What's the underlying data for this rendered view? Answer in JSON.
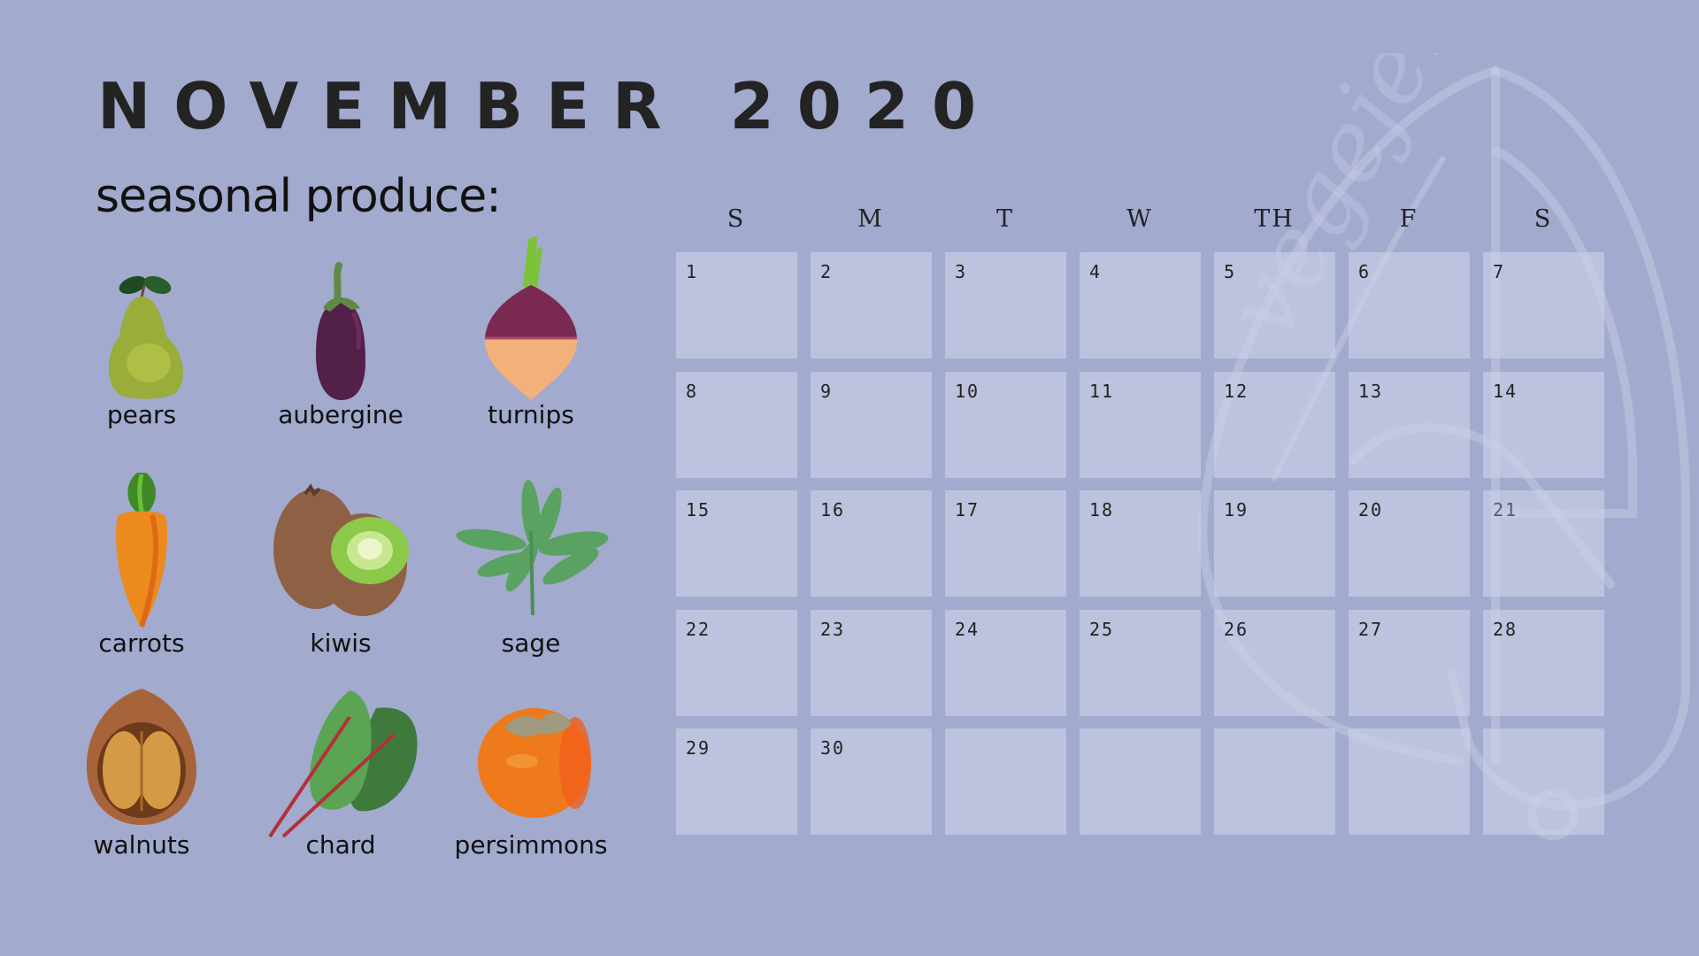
{
  "title": "NOVEMBER 2020",
  "subtitle": "seasonal produce:",
  "produce": [
    {
      "name": "pears",
      "icon": "pear-icon"
    },
    {
      "name": "aubergine",
      "icon": "aubergine-icon"
    },
    {
      "name": "turnips",
      "icon": "turnip-icon"
    },
    {
      "name": "carrots",
      "icon": "carrot-icon"
    },
    {
      "name": "kiwis",
      "icon": "kiwi-icon"
    },
    {
      "name": "sage",
      "icon": "sage-icon"
    },
    {
      "name": "walnuts",
      "icon": "walnut-icon"
    },
    {
      "name": "chard",
      "icon": "chard-icon"
    },
    {
      "name": "persimmons",
      "icon": "persimmon-icon"
    }
  ],
  "calendar": {
    "weekdays": [
      "S",
      "M",
      "T",
      "W",
      "TH",
      "F",
      "S"
    ],
    "weeks": [
      [
        "1",
        "2",
        "3",
        "4",
        "5",
        "6",
        "7"
      ],
      [
        "8",
        "9",
        "10",
        "11",
        "12",
        "13",
        "14"
      ],
      [
        "15",
        "16",
        "17",
        "18",
        "19",
        "20",
        "21"
      ],
      [
        "22",
        "23",
        "24",
        "25",
        "26",
        "27",
        "28"
      ],
      [
        "29",
        "30",
        "",
        "",
        "",
        "",
        ""
      ]
    ],
    "muted_days": [
      "21"
    ]
  },
  "colors": {
    "background": "#A2AACE",
    "cell": "#BCC1DC",
    "text": "#222222"
  },
  "watermark": "vegejera"
}
